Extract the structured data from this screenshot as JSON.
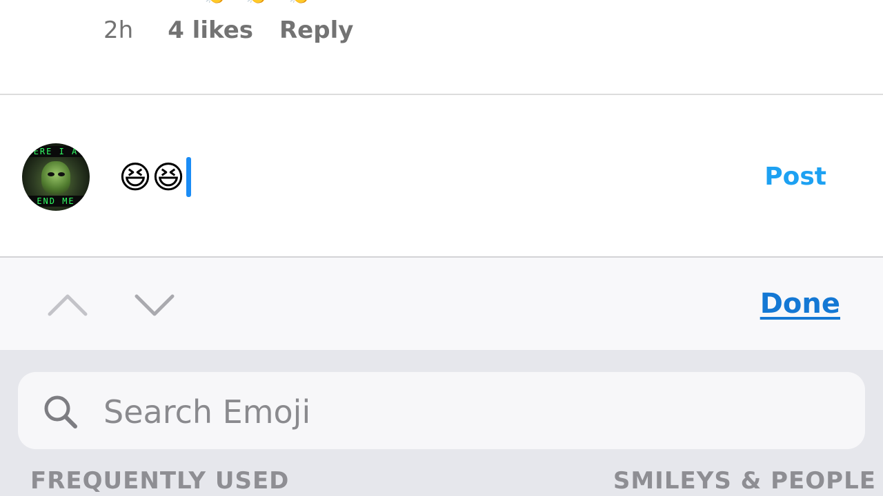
{
  "comment": {
    "reactions": [
      "👏",
      "👏",
      "👏"
    ],
    "time": "2h",
    "likes": "4 likes",
    "reply_label": "Reply"
  },
  "compose": {
    "avatar_text_top": "ERE I A",
    "avatar_text_bottom": "END ME",
    "input_value": "😆😆",
    "post_label": "Post"
  },
  "accessory": {
    "up_icon": "chevron-up-icon",
    "down_icon": "chevron-down-icon",
    "done_label": "Done"
  },
  "emoji_keyboard": {
    "search_placeholder": "Search Emoji",
    "search_icon": "search-icon",
    "categories": [
      "FREQUENTLY USED",
      "SMILEYS & PEOPLE"
    ]
  },
  "colors": {
    "post": "#1da1f2",
    "done": "#1478d4",
    "caret": "#1a8cf5",
    "meta_text": "#737373",
    "keyboard_bg": "#e6e7ec"
  }
}
